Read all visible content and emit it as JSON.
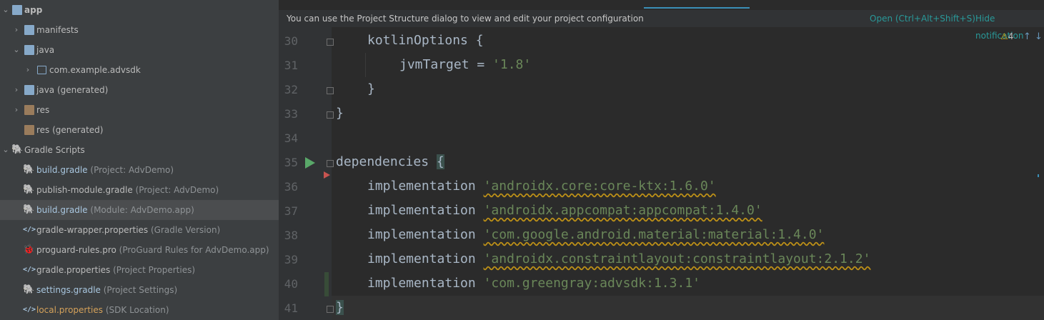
{
  "tree": {
    "app": {
      "label": "app"
    },
    "manifests": {
      "label": "manifests"
    },
    "java": {
      "label": "java"
    },
    "package": {
      "label": "com.example.advsdk"
    },
    "java_generated": {
      "label": "java (generated)"
    },
    "res": {
      "label": "res"
    },
    "res_generated": {
      "label": "res (generated)"
    },
    "gradle_scripts": {
      "label": "Gradle Scripts"
    },
    "build_gradle_project": {
      "label": "build.gradle",
      "hint": "(Project: AdvDemo)"
    },
    "publish_module": {
      "label": "publish-module.gradle",
      "hint": "(Project: AdvDemo)"
    },
    "build_gradle_module": {
      "label": "build.gradle",
      "hint": "(Module: AdvDemo.app)"
    },
    "gradle_wrapper": {
      "label": "gradle-wrapper.properties",
      "hint": "(Gradle Version)"
    },
    "proguard": {
      "label": "proguard-rules.pro",
      "hint": "(ProGuard Rules for AdvDemo.app)"
    },
    "gradle_properties": {
      "label": "gradle.properties",
      "hint": "(Project Properties)"
    },
    "settings_gradle": {
      "label": "settings.gradle",
      "hint": "(Project Settings)"
    },
    "local_properties": {
      "label": "local.properties",
      "hint": "(SDK Location)"
    }
  },
  "notification": {
    "message": "You can use the Project Structure dialog to view and edit your project configuration",
    "open_label": "Open (Ctrl+Alt+Shift+S)",
    "hide_label": "Hide notification"
  },
  "inspection": {
    "warning_count": "4"
  },
  "code": {
    "line_numbers": [
      "30",
      "31",
      "32",
      "33",
      "34",
      "35",
      "36",
      "37",
      "38",
      "39",
      "40",
      "41"
    ],
    "l30": "kotlinOptions {",
    "l31_a": "jvmTarget = ",
    "l31_b": "'1.8'",
    "l32": "}",
    "l33": "}",
    "l35_a": "dependencies ",
    "l35_b": "{",
    "impl": "implementation",
    "l36": "'androidx.core:core-ktx:1.6.0'",
    "l37": "'androidx.appcompat:appcompat:1.4.0'",
    "l38": "'com.google.android.material:material:1.4.0'",
    "l39": "'androidx.constraintlayout:constraintlayout:2.1.2'",
    "l40": "'com.greengray:advsdk:1.3.1'",
    "l41": "}"
  },
  "colors": {
    "accent": "#299999",
    "string": "#6a8759",
    "warning": "#be9117",
    "run": "#59a869"
  }
}
